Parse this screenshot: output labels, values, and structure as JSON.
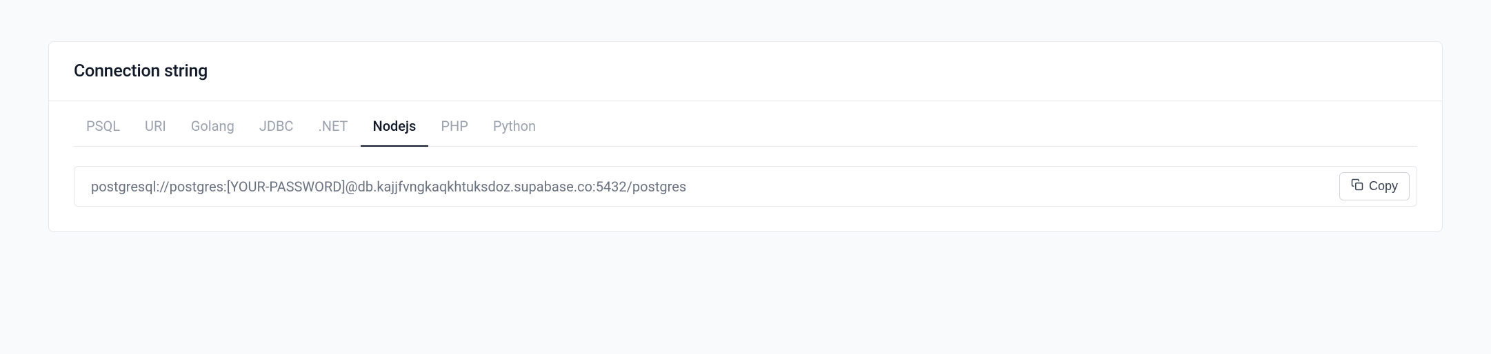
{
  "section": {
    "title": "Connection string"
  },
  "tabs": {
    "items": [
      {
        "label": "PSQL"
      },
      {
        "label": "URI"
      },
      {
        "label": "Golang"
      },
      {
        "label": "JDBC"
      },
      {
        "label": ".NET"
      },
      {
        "label": "Nodejs"
      },
      {
        "label": "PHP"
      },
      {
        "label": "Python"
      }
    ],
    "active_index": 5
  },
  "connection": {
    "value": "postgresql://postgres:[YOUR-PASSWORD]@db.kajjfvngkaqkhtuksdoz.supabase.co:5432/postgres"
  },
  "copy": {
    "label": "Copy"
  }
}
